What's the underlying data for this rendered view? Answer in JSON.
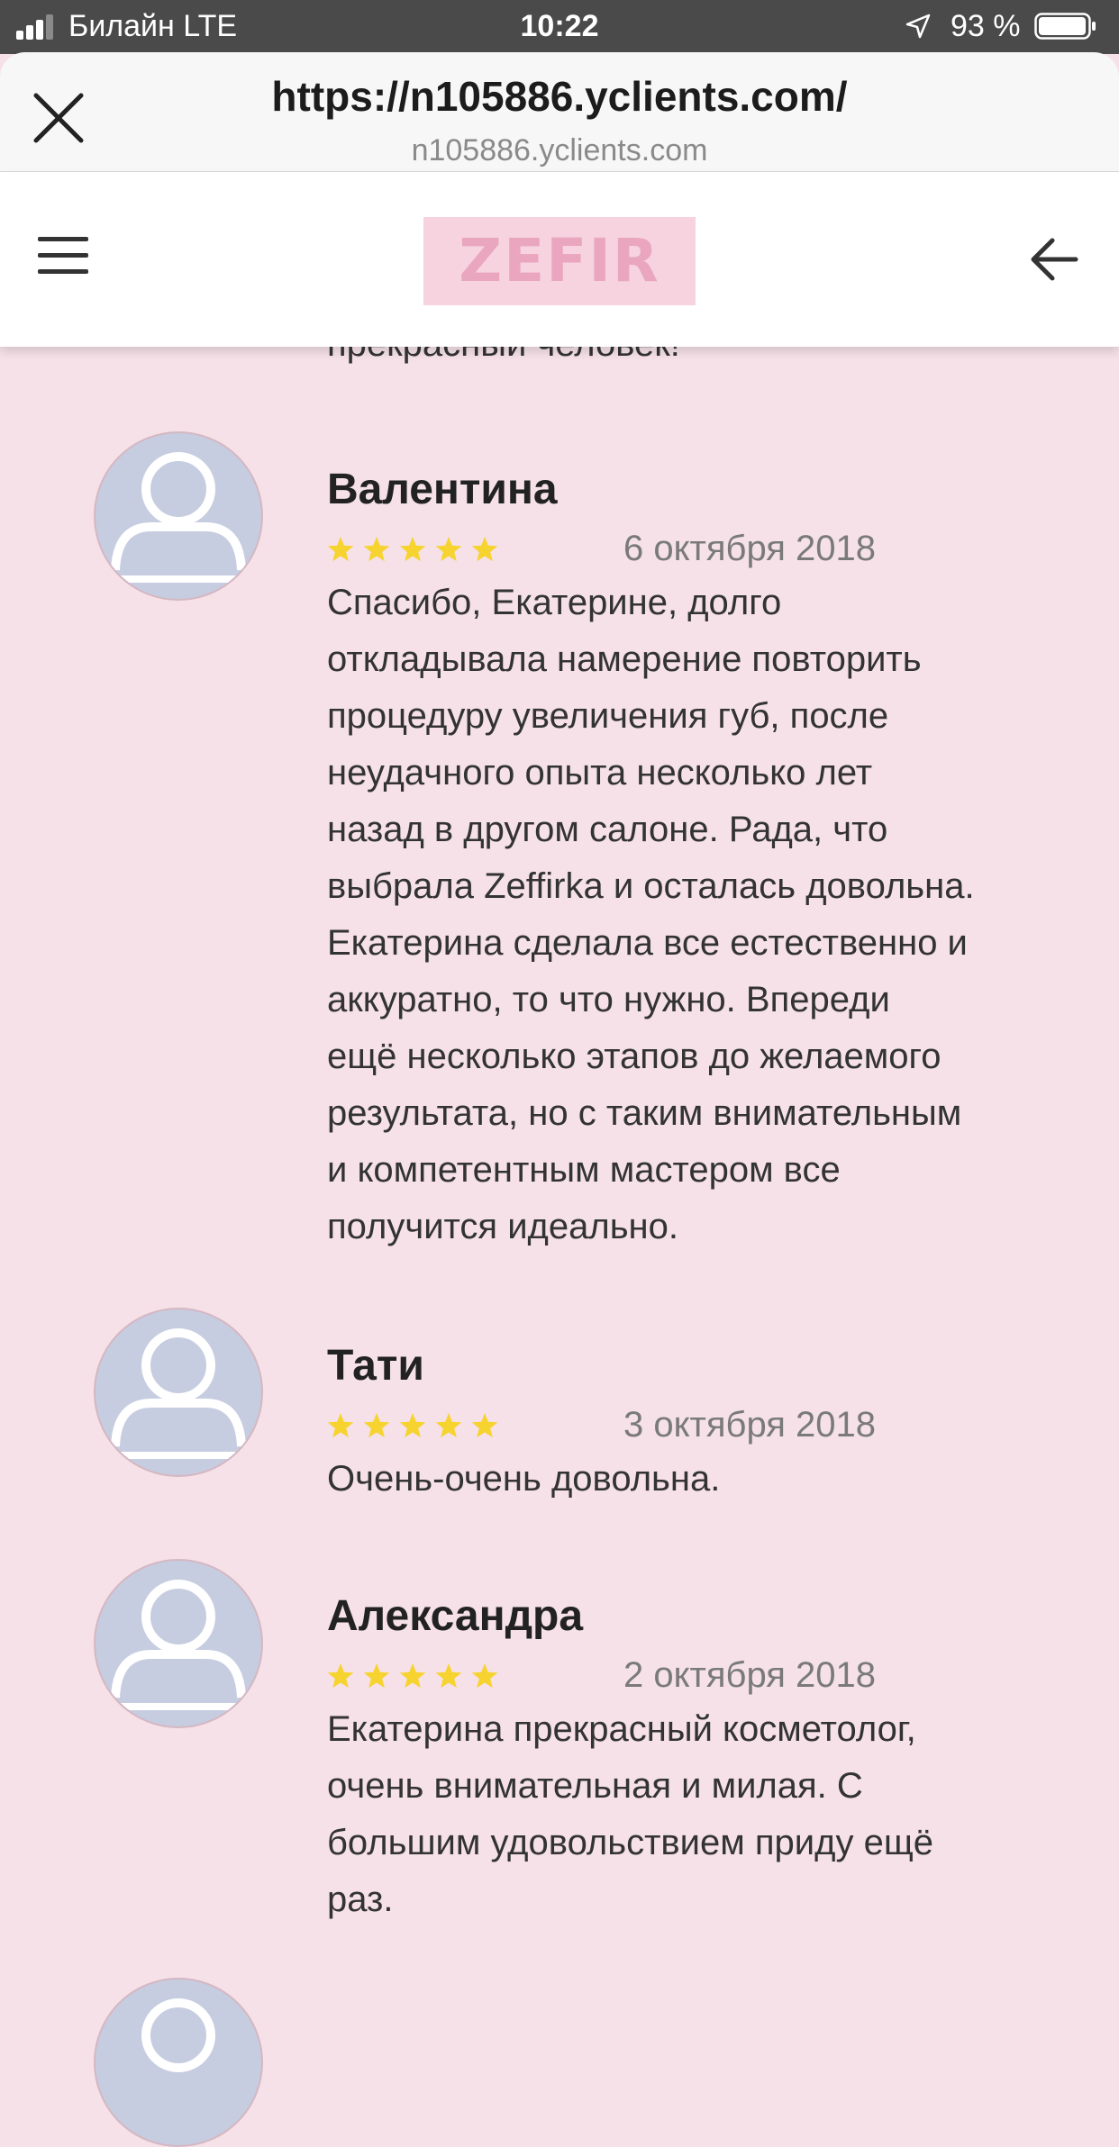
{
  "status_bar": {
    "carrier": "Билайн  LTE",
    "time": "10:22",
    "battery": "93 %"
  },
  "browser": {
    "url": "https://n105886.yclients.com/",
    "domain": "n105886.yclients.com"
  },
  "header": {
    "logo_text": "ZEFIR"
  },
  "partial_review_tail": "прекрасный человек!",
  "reviews": [
    {
      "name": "Валентина",
      "rating": 5,
      "date": "6 октября 2018",
      "lines": [
        "Спасибо, Екатерине, долго",
        "откладывала намерение повторить",
        "процедуру увеличения губ, после",
        "неудачного опыта несколько лет",
        "назад в другом салоне. Рада, что",
        "выбрала Zeffirka и осталась довольна.",
        "Екатерина сделала все естественно и",
        "аккуратно, то что нужно. Впереди",
        "ещё несколько этапов до желаемого",
        "результата, но с таким внимательным",
        "и компетентным мастером все",
        "получится идеально."
      ]
    },
    {
      "name": "Тати",
      "rating": 5,
      "date": "3 октября 2018",
      "lines": [
        "Очень-очень довольна."
      ]
    },
    {
      "name": "Александра",
      "rating": 5,
      "date": "2 октября 2018",
      "lines": [
        "Екатерина прекрасный косметолог,",
        "очень внимательная и милая. С",
        "большим удовольствием приду ещё",
        "раз."
      ]
    }
  ],
  "colors": {
    "page_bg": "#f5e1e7",
    "star": "#f7d330",
    "avatar_bg": "#c7cde0",
    "logo_bg": "#f6d3df",
    "logo_text": "#eaa6bf"
  },
  "icons": {
    "close": "close-icon",
    "menu": "hamburger-menu-icon",
    "back": "arrow-left-icon",
    "avatar": "user-placeholder-icon",
    "star": "star-icon"
  }
}
